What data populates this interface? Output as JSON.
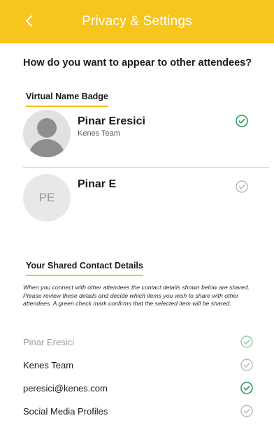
{
  "header": {
    "title": "Privacy & Settings",
    "background": "#f7c61d",
    "back_icon": "chevron-left-icon"
  },
  "prompt": {
    "question": "How do you want to appear to other attendees?"
  },
  "virtual_badge": {
    "section_title": "Virtual Name Badge",
    "options": [
      {
        "name": "Pinar Eresici",
        "subtitle": "Kenes Team",
        "avatar": "photo",
        "selected": true
      },
      {
        "name": "Pinar E",
        "initials": "PE",
        "avatar": "initials",
        "selected": false
      }
    ]
  },
  "contact_details": {
    "section_title": "Your Shared Contact Details",
    "description": "When you connect with other attendees the contact details shown below are shared. Please review these details and decide which items you wish to share with other attendees. A green check mark confirms that the selected item will be shared.",
    "items": [
      {
        "label": "Pinar Eresici",
        "shared": true
      },
      {
        "label": "Kenes Team",
        "shared": false
      },
      {
        "label": "peresici@kenes.com",
        "shared": true
      },
      {
        "label": "Social Media Profiles",
        "shared": false
      }
    ]
  },
  "colors": {
    "accent": "#f7c61d",
    "check_on": "#2f9c5e",
    "check_on_light": "#8fd2a8",
    "check_off": "#b8b8b8"
  }
}
